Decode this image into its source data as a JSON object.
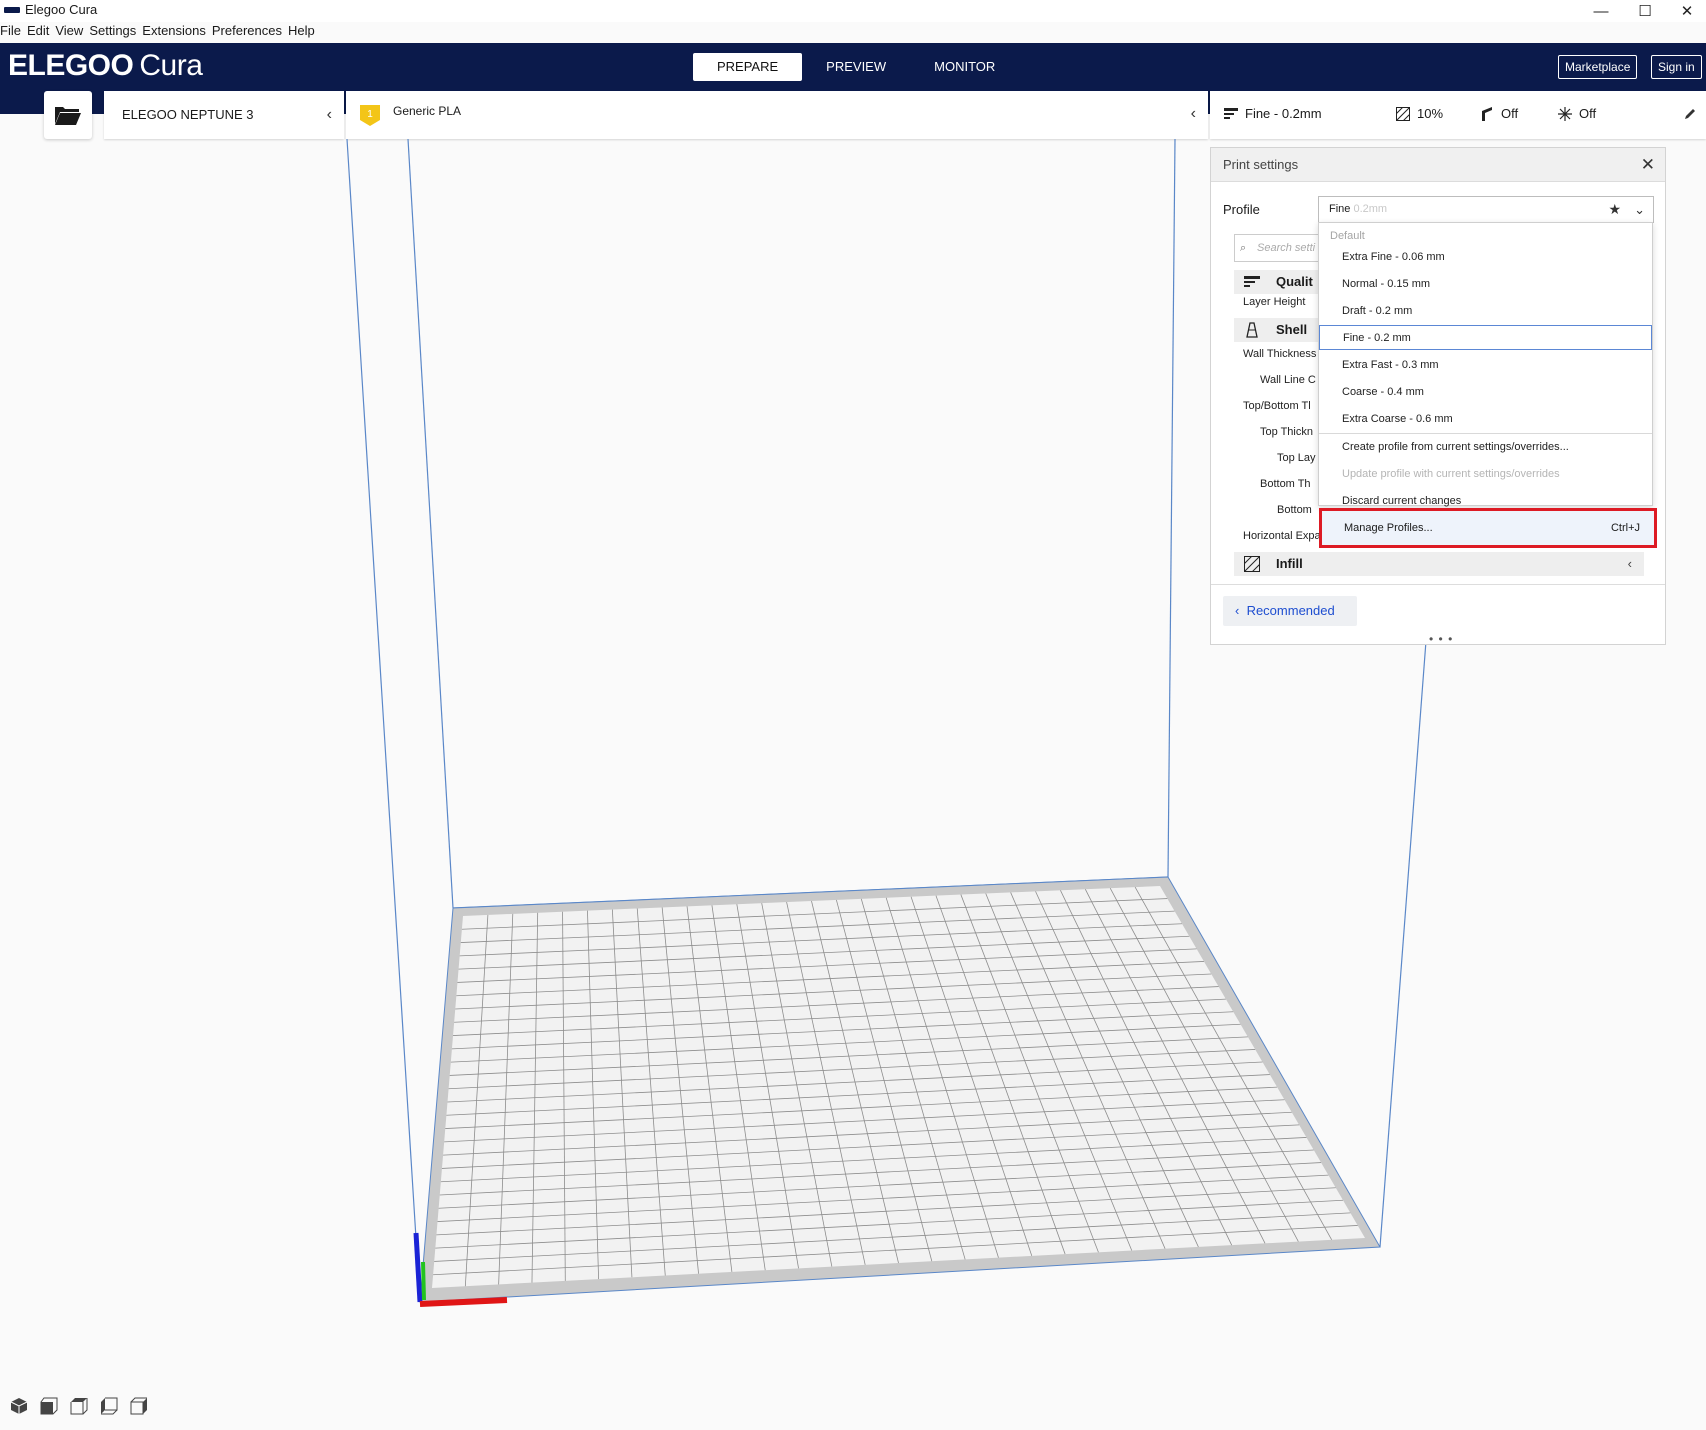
{
  "window": {
    "title": "Elegoo Cura",
    "minimize": "—",
    "maximize": "☐",
    "close": "✕"
  },
  "menu": [
    "File",
    "Edit",
    "View",
    "Settings",
    "Extensions",
    "Preferences",
    "Help"
  ],
  "header": {
    "logo_brand": "ELEGOO",
    "logo_product": "Cura",
    "tabs": [
      {
        "label": "PREPARE",
        "active": true
      },
      {
        "label": "PREVIEW",
        "active": false
      },
      {
        "label": "MONITOR",
        "active": false
      }
    ],
    "marketplace": "Marketplace",
    "sign_in": "Sign in",
    "brand_color": "#0b1a4b"
  },
  "toolbar": {
    "open_icon": "folder-open-icon",
    "printer": "ELEGOO NEPTUNE 3",
    "material_badge": "1",
    "material": "Generic PLA",
    "print": {
      "profile": "Fine - 0.2mm",
      "infill": "10%",
      "support": "Off",
      "adhesion": "Off"
    }
  },
  "panel": {
    "title": "Print settings",
    "profile_label": "Profile",
    "profile_value": "Fine",
    "profile_value_muted": "0.2mm",
    "search_placeholder": "Search setti",
    "categories": [
      {
        "label": "Qualit",
        "icon": "quality-icon"
      },
      {
        "label": "Shell",
        "icon": "shell-icon"
      },
      {
        "label": "Infill",
        "icon": "infill-icon"
      }
    ],
    "settings": {
      "layer_height": "Layer Height",
      "wall_thickness": "Wall Thickness",
      "wall_line": "Wall Line C",
      "top_bottom": "Top/Bottom Tl",
      "top_thickness": "Top Thickn",
      "top_layers": "Top Lay",
      "bottom_thickness": "Bottom Th",
      "bottom_layers": "Bottom",
      "horizontal_expansion": "Horizontal Expansion"
    },
    "recommended": "Recommended",
    "grip": "• • •"
  },
  "dropdown": {
    "section_header": "Default",
    "profiles": [
      {
        "label": "Extra Fine - 0.06 mm",
        "selected": false
      },
      {
        "label": "Normal - 0.15 mm",
        "selected": false
      },
      {
        "label": "Draft - 0.2 mm",
        "selected": false
      },
      {
        "label": "Fine - 0.2 mm",
        "selected": true
      },
      {
        "label": "Extra Fast - 0.3 mm",
        "selected": false
      },
      {
        "label": "Coarse - 0.4 mm",
        "selected": false
      },
      {
        "label": "Extra Coarse - 0.6 mm",
        "selected": false
      }
    ],
    "actions": {
      "create": "Create profile from current settings/overrides...",
      "update": "Update profile with current settings/overrides",
      "discard": "Discard current changes",
      "manage": "Manage Profiles...",
      "manage_shortcut": "Ctrl+J"
    },
    "highlight_color": "#dd1a24"
  },
  "view_controls": [
    "3d-view-icon",
    "front-view-icon",
    "top-view-icon",
    "left-view-icon",
    "right-view-icon"
  ]
}
